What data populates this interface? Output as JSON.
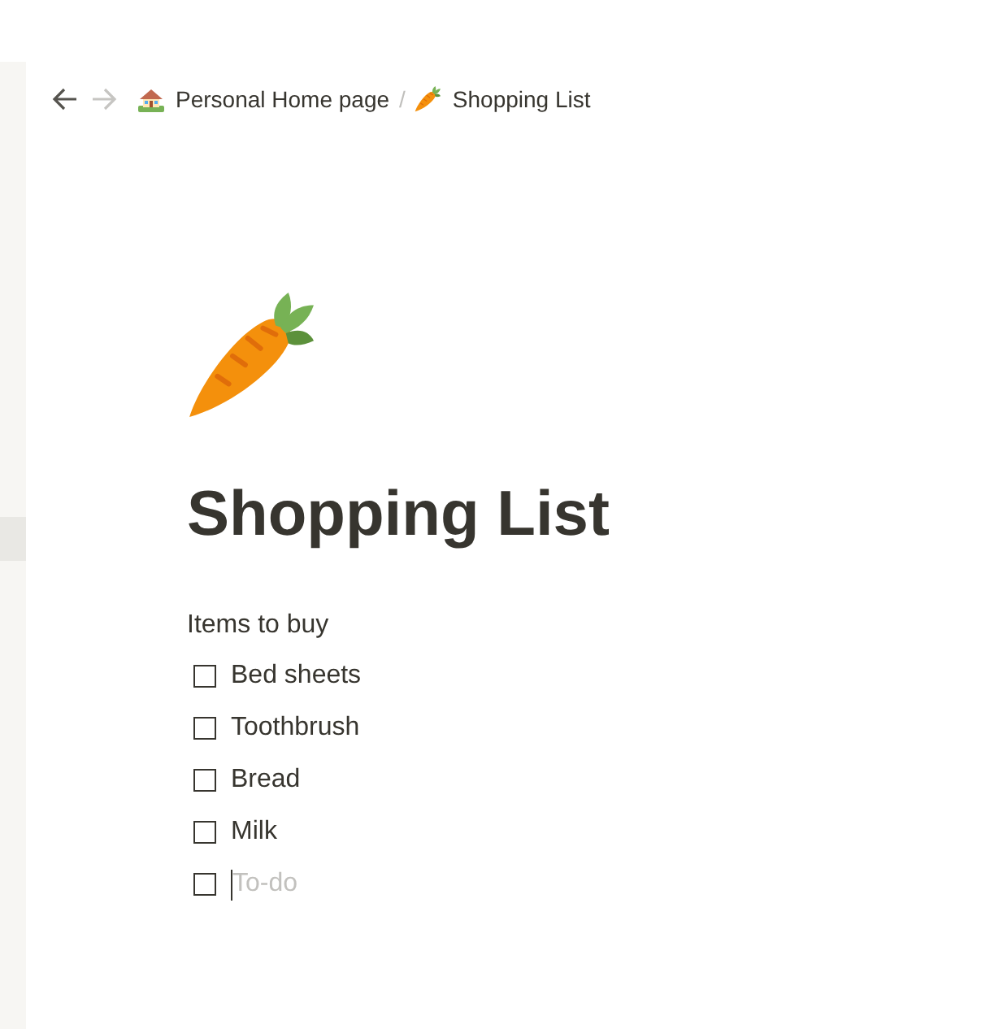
{
  "sidebar": {
    "items": [
      {
        "selected": true
      }
    ]
  },
  "topbar": {
    "back": {
      "disabled": false
    },
    "forward": {
      "disabled": true
    },
    "breadcrumb": [
      {
        "label": "Personal Home page"
      },
      {
        "label": "Shopping List"
      }
    ],
    "separator": "/"
  },
  "page": {
    "title": "Shopping List",
    "blocks": [
      {
        "kind": "text",
        "text": "Items to buy"
      },
      {
        "kind": "todo",
        "text": "Bed sheets",
        "checked": false,
        "focused": false
      },
      {
        "kind": "todo",
        "text": "Toothbrush",
        "checked": false,
        "focused": false
      },
      {
        "kind": "todo",
        "text": "Bread",
        "checked": false,
        "focused": false
      },
      {
        "kind": "todo",
        "text": "Milk",
        "checked": false,
        "focused": false
      },
      {
        "kind": "todo",
        "placeholder": "To-do",
        "checked": false,
        "focused": true
      }
    ]
  }
}
